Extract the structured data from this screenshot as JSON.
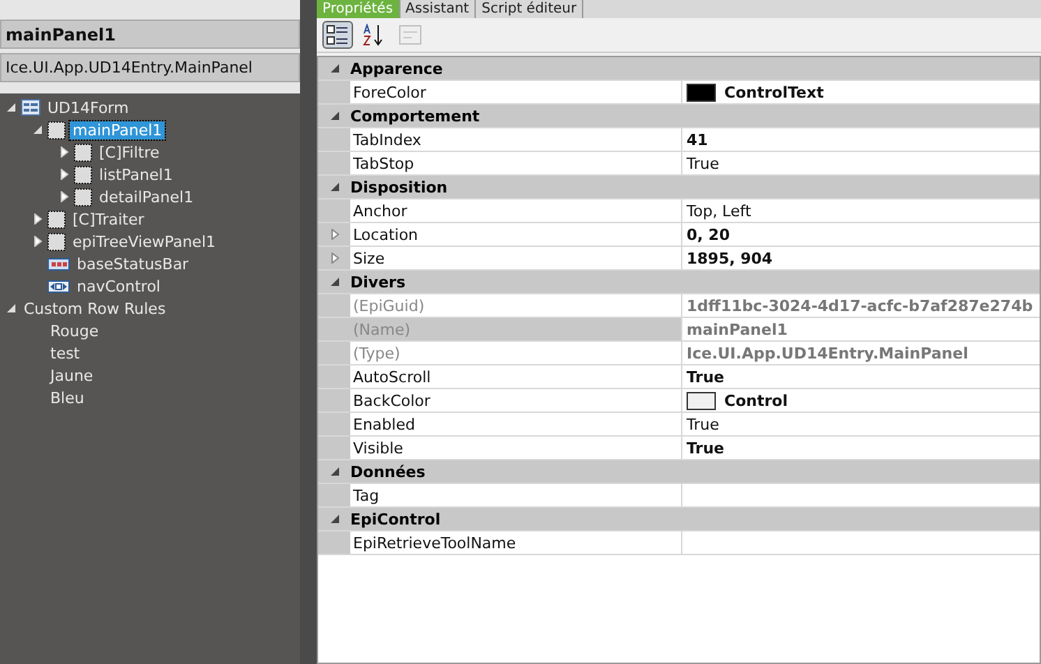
{
  "header": {
    "title": "mainPanel1",
    "type": "Ice.UI.App.UD14Entry.MainPanel"
  },
  "tree": [
    {
      "label": "UD14Form",
      "kind": "form",
      "expanded": true,
      "selected": false,
      "children": [
        {
          "label": "mainPanel1",
          "kind": "panel",
          "expanded": true,
          "selected": true,
          "children": [
            {
              "label": "[C]Filtre",
              "kind": "panel",
              "expanded": false,
              "selected": false
            },
            {
              "label": "listPanel1",
              "kind": "panel",
              "expanded": false,
              "selected": false
            },
            {
              "label": "detailPanel1",
              "kind": "panel",
              "expanded": false,
              "selected": false
            }
          ]
        },
        {
          "label": "[C]Traiter",
          "kind": "panel",
          "expanded": false,
          "selected": false
        },
        {
          "label": "epiTreeViewPanel1",
          "kind": "panel",
          "expanded": false,
          "selected": false
        },
        {
          "label": "baseStatusBar",
          "kind": "statusbar",
          "selected": false
        },
        {
          "label": "navControl",
          "kind": "nav",
          "selected": false
        }
      ]
    },
    {
      "label": "Custom Row Rules",
      "kind": "rule",
      "expanded": true,
      "selected": false,
      "children": [
        {
          "label": "Rouge",
          "kind": "rule",
          "selected": false
        },
        {
          "label": "test",
          "kind": "rule",
          "selected": false
        },
        {
          "label": "Jaune",
          "kind": "rule",
          "selected": false
        },
        {
          "label": "Bleu",
          "kind": "rule",
          "selected": false
        }
      ]
    }
  ],
  "tabs": [
    {
      "label": "Propriétés",
      "selected": true
    },
    {
      "label": "Assistant",
      "selected": false
    },
    {
      "label": "Script éditeur",
      "selected": false
    }
  ],
  "toolbar": [
    {
      "kind": "categorized",
      "selected": true,
      "disabled": false
    },
    {
      "kind": "alphabetical",
      "selected": false,
      "disabled": false
    },
    {
      "kind": "pages",
      "selected": false,
      "disabled": true
    }
  ],
  "categories": [
    {
      "name": "Apparence",
      "expanded": true,
      "rows": [
        {
          "name": "ForeColor",
          "value": "ControlText",
          "modified": true,
          "color": "#000000"
        }
      ]
    },
    {
      "name": "Comportement",
      "expanded": true,
      "rows": [
        {
          "name": "TabIndex",
          "value": "41",
          "modified": true
        },
        {
          "name": "TabStop",
          "value": "True",
          "modified": false
        }
      ]
    },
    {
      "name": "Disposition",
      "expanded": true,
      "rows": [
        {
          "name": "Anchor",
          "value": "Top, Left",
          "modified": false
        },
        {
          "name": "Location",
          "value": "0, 20",
          "modified": true,
          "expandable": true
        },
        {
          "name": "Size",
          "value": "1895, 904",
          "modified": true,
          "expandable": true
        }
      ]
    },
    {
      "name": "Divers",
      "expanded": true,
      "rows": [
        {
          "name": "(EpiGuid)",
          "value": "1dff11bc-3024-4d17-acfc-b7af287e274b",
          "modified": true,
          "readonly": true
        },
        {
          "name": "(Name)",
          "value": "mainPanel1",
          "modified": true,
          "readonly": true,
          "selected": true
        },
        {
          "name": "(Type)",
          "value": "Ice.UI.App.UD14Entry.MainPanel",
          "modified": true,
          "readonly": true
        },
        {
          "name": "AutoScroll",
          "value": "True",
          "modified": true
        },
        {
          "name": "BackColor",
          "value": "Control",
          "modified": true,
          "color": "#f0f0f0"
        },
        {
          "name": "Enabled",
          "value": "True",
          "modified": false
        },
        {
          "name": "Visible",
          "value": "True",
          "modified": true
        }
      ]
    },
    {
      "name": "Données",
      "expanded": true,
      "rows": [
        {
          "name": "Tag"
        }
      ]
    },
    {
      "name": "EpiControl",
      "expanded": true,
      "rows": [
        {
          "name": "EpiRetrieveToolName"
        }
      ]
    }
  ]
}
